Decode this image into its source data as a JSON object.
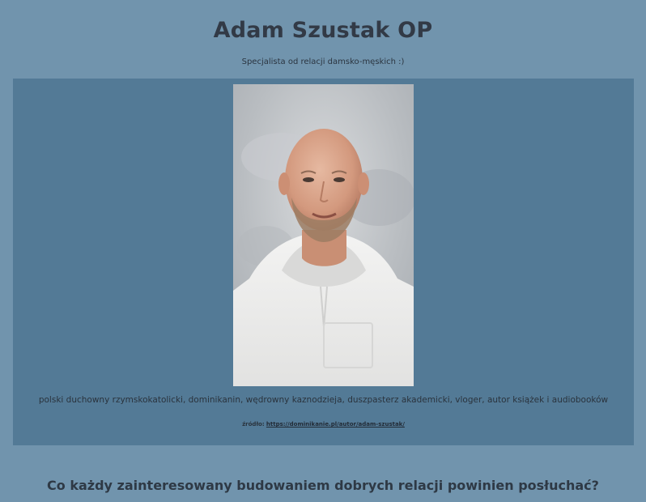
{
  "header": {
    "title": "Adam Szustak OP",
    "subtitle": "Specjalista od relacji damsko-męskich :)"
  },
  "profile": {
    "photo_alt": "Adam Szustak OP",
    "description": "polski duchowny rzymskokatolicki, dominikanin, wędrowny kaznodzieja, duszpasterz akademicki, vloger, autor książek i audiobooków",
    "source_label": "źródło:",
    "source_link": "https://dominikanie.pl/autor/adam-szustak/"
  },
  "section": {
    "heading": "Co każdy zainteresowany budowaniem dobrych relacji powinien posłuchać?"
  },
  "colors": {
    "page_background": "#7194ad",
    "card_background": "#537a96",
    "text": "#323a46"
  }
}
